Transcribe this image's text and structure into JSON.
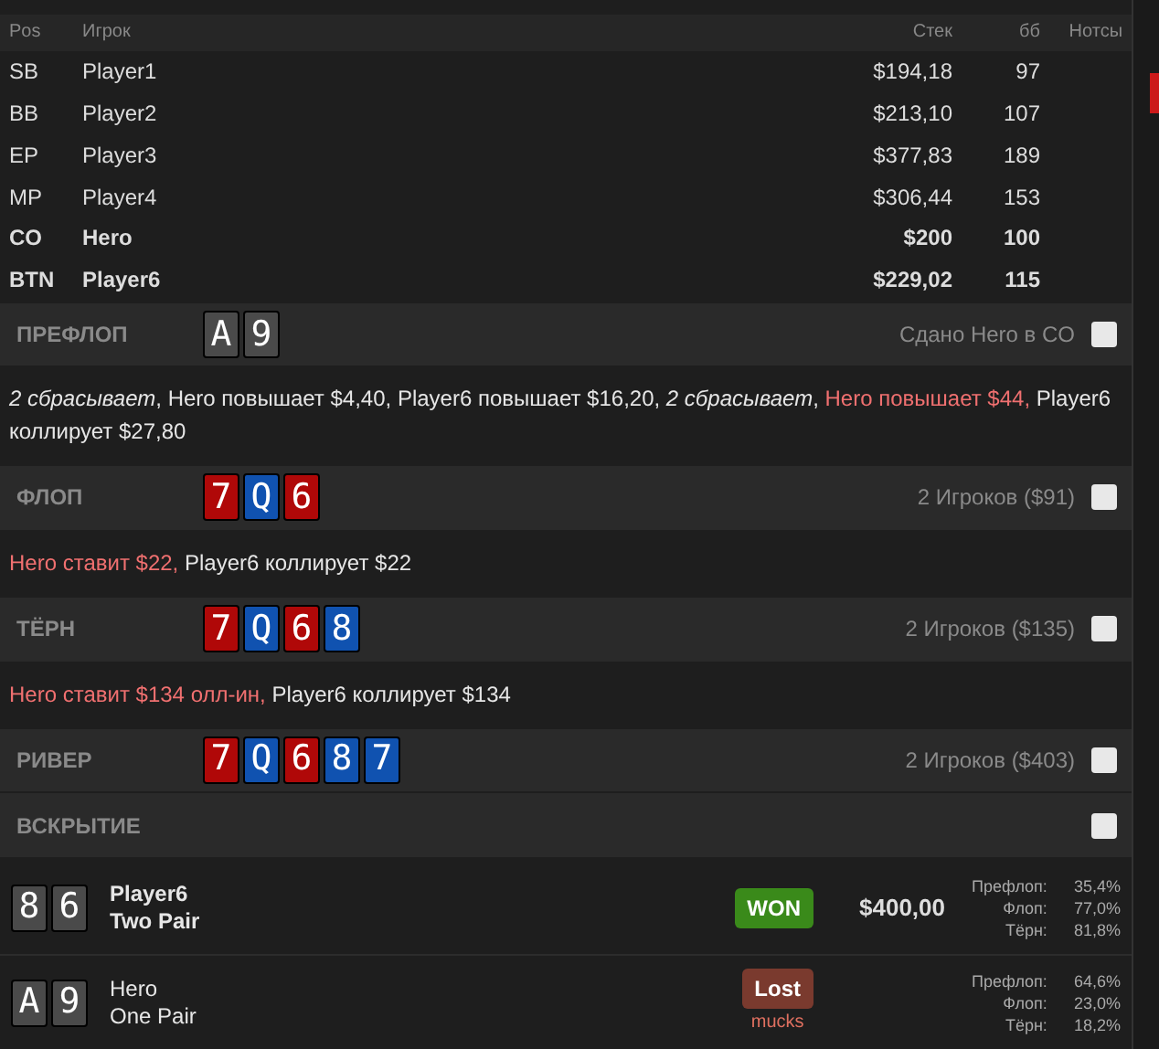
{
  "table": {
    "columns": [
      "Pos",
      "Игрок",
      "Стек",
      "бб",
      "Нотсы"
    ],
    "rows": [
      {
        "pos": "SB",
        "player": "Player1",
        "stack": "$194,18",
        "bb": "97",
        "hero": false
      },
      {
        "pos": "BB",
        "player": "Player2",
        "stack": "$213,10",
        "bb": "107",
        "hero": false
      },
      {
        "pos": "EP",
        "player": "Player3",
        "stack": "$377,83",
        "bb": "189",
        "hero": false
      },
      {
        "pos": "MP",
        "player": "Player4",
        "stack": "$306,44",
        "bb": "153",
        "hero": false
      },
      {
        "pos": "CO",
        "player": "Hero",
        "stack": "$200",
        "bb": "100",
        "hero": true
      },
      {
        "pos": "BTN",
        "player": "Player6",
        "stack": "$229,02",
        "bb": "115",
        "hero": true
      }
    ]
  },
  "streets": [
    {
      "name": "ПРЕФЛОП",
      "cards": [
        {
          "rank": "A",
          "color": "#4a4a4a"
        },
        {
          "rank": "9",
          "color": "#4a4a4a"
        }
      ],
      "info": "Сдано Hero в CO",
      "checked": false,
      "actions": [
        {
          "text": "2 сбрасывает",
          "kind": "fold"
        },
        {
          "text": ", ",
          "kind": "normal"
        },
        {
          "text": "Hero повышает $4,40, Player6 повышает $16,20, ",
          "kind": "normal"
        },
        {
          "text": "2 сбрасывает",
          "kind": "fold"
        },
        {
          "text": ", ",
          "kind": "normal"
        },
        {
          "text": "Hero повышает $44,",
          "kind": "hero"
        },
        {
          "text": " Player6 коллирует $27,80",
          "kind": "normal"
        }
      ]
    },
    {
      "name": "ФЛОП",
      "cards": [
        {
          "rank": "7",
          "color": "#b00808"
        },
        {
          "rank": "Q",
          "color": "#1052b0"
        },
        {
          "rank": "6",
          "color": "#b00808"
        }
      ],
      "info": "2 Игроков ($91)",
      "checked": false,
      "actions": [
        {
          "text": "Hero ставит $22,",
          "kind": "hero"
        },
        {
          "text": " Player6 коллирует $22",
          "kind": "normal"
        }
      ]
    },
    {
      "name": "ТЁРН",
      "cards": [
        {
          "rank": "7",
          "color": "#b00808"
        },
        {
          "rank": "Q",
          "color": "#1052b0"
        },
        {
          "rank": "6",
          "color": "#b00808"
        },
        {
          "rank": "8",
          "color": "#1052b0"
        }
      ],
      "info": "2 Игроков ($135)",
      "checked": false,
      "actions": [
        {
          "text": "Hero ставит $134 олл-ин,",
          "kind": "hero"
        },
        {
          "text": " Player6 коллирует $134",
          "kind": "normal"
        }
      ]
    },
    {
      "name": "РИВЕР",
      "cards": [
        {
          "rank": "7",
          "color": "#b00808"
        },
        {
          "rank": "Q",
          "color": "#1052b0"
        },
        {
          "rank": "6",
          "color": "#b00808"
        },
        {
          "rank": "8",
          "color": "#1052b0"
        },
        {
          "rank": "7",
          "color": "#1052b0"
        }
      ],
      "info": "2 Игроков ($403)",
      "checked": false
    },
    {
      "name": "ВСКРЫТИЕ",
      "checked": false
    }
  ],
  "showdown": [
    {
      "cards": [
        {
          "rank": "8",
          "color": "#4a4a4a"
        },
        {
          "rank": "6",
          "color": "#4a4a4a"
        }
      ],
      "player": "Player6",
      "hand": "Two Pair",
      "bold": true,
      "result": "WON",
      "kind": "won",
      "amount": "$400,00",
      "equity": [
        {
          "label": "Префлоп:",
          "value": "35,4%"
        },
        {
          "label": "Флоп:",
          "value": "77,0%"
        },
        {
          "label": "Тёрн:",
          "value": "81,8%"
        }
      ]
    },
    {
      "cards": [
        {
          "rank": "A",
          "color": "#4a4a4a"
        },
        {
          "rank": "9",
          "color": "#4a4a4a"
        }
      ],
      "player": "Hero",
      "hand": "One Pair",
      "bold": false,
      "result": "Lost",
      "kind": "lost",
      "note": "mucks",
      "equity": [
        {
          "label": "Префлоп:",
          "value": "64,6%"
        },
        {
          "label": "Флоп:",
          "value": "23,0%"
        },
        {
          "label": "Тёрн:",
          "value": "18,2%"
        }
      ]
    }
  ]
}
